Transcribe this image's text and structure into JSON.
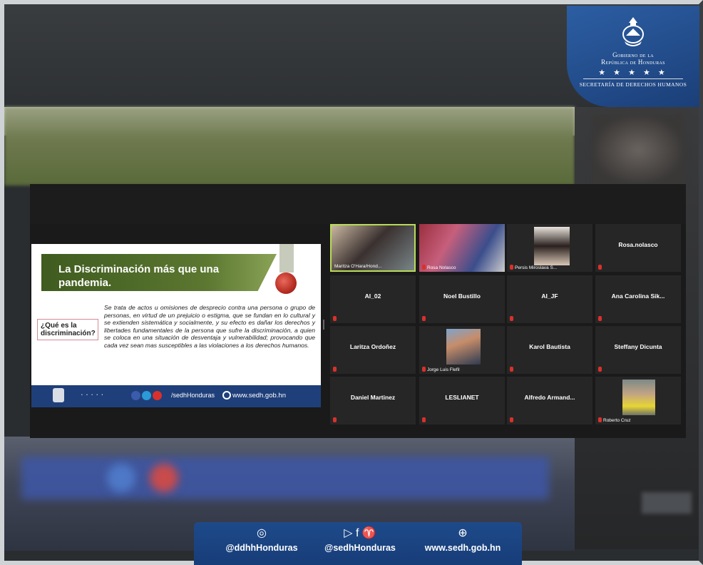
{
  "gov_badge": {
    "title_line1": "Gobierno de la",
    "title_line2": "República de Honduras",
    "stars": "★ ★ ★ ★ ★",
    "department": "SECRETARÍA DE DERECHOS HUMANOS"
  },
  "slide": {
    "title": "La Discriminación más que una pandemia.",
    "question": "¿Qué es la discriminación?",
    "body": "Se trata de actos u omisiones de desprecio contra una persona o grupo de personas, en virtud de un prejuicio o estigma, que se fundan en lo cultural y se extienden sistemática y socialmente, y su efecto es dañar los derechos y libertades fundamentales de la persona que sufre la discriminación, a quien se coloca en una situación de desventaja y vulnerabilidad; provocando que cada vez sean mas susceptibles a las violaciones a los derechos humanos.",
    "footer_handle": "/sedhHonduras",
    "footer_web": "www.sedh.gob.hn"
  },
  "participants": [
    {
      "name": "",
      "label": "Maritza O'Hara/Hond...",
      "video": true,
      "active": true
    },
    {
      "name": "",
      "label": "Rosa Nolasco",
      "video": true
    },
    {
      "name": "",
      "label": "Persis Miroslava S...",
      "video": true
    },
    {
      "name": "Rosa.nolasco",
      "label": "",
      "video": false
    },
    {
      "name": "AI_02",
      "label": "",
      "video": false
    },
    {
      "name": "Noel Bustillo",
      "label": "",
      "video": false
    },
    {
      "name": "AI_JF",
      "label": "",
      "video": false
    },
    {
      "name": "Ana Carolina Sik...",
      "label": "",
      "video": false
    },
    {
      "name": "Laritza Ordoñez",
      "label": "",
      "video": false
    },
    {
      "name": "",
      "label": "Jorge Luis Flefil",
      "video": true
    },
    {
      "name": "Karol Bautista",
      "label": "",
      "video": false
    },
    {
      "name": "Steffany Dicunta",
      "label": "",
      "video": false
    },
    {
      "name": "Daniel Martinez",
      "label": "",
      "video": false
    },
    {
      "name": "LESLIANET",
      "label": "",
      "video": false
    },
    {
      "name": "Alfredo Armand...",
      "label": "",
      "video": false
    },
    {
      "name": "",
      "label": "Roberto Cruz",
      "video": true
    }
  ],
  "social_bar": {
    "instagram": "@ddhhHonduras",
    "youtube_fb_twitter": "@sedhHonduras",
    "web": "www.sedh.gob.hn"
  },
  "colors": {
    "active_speaker": "#b9db57",
    "brand_blue": "#1f3f7a",
    "muted_mic": "#d9312b"
  }
}
